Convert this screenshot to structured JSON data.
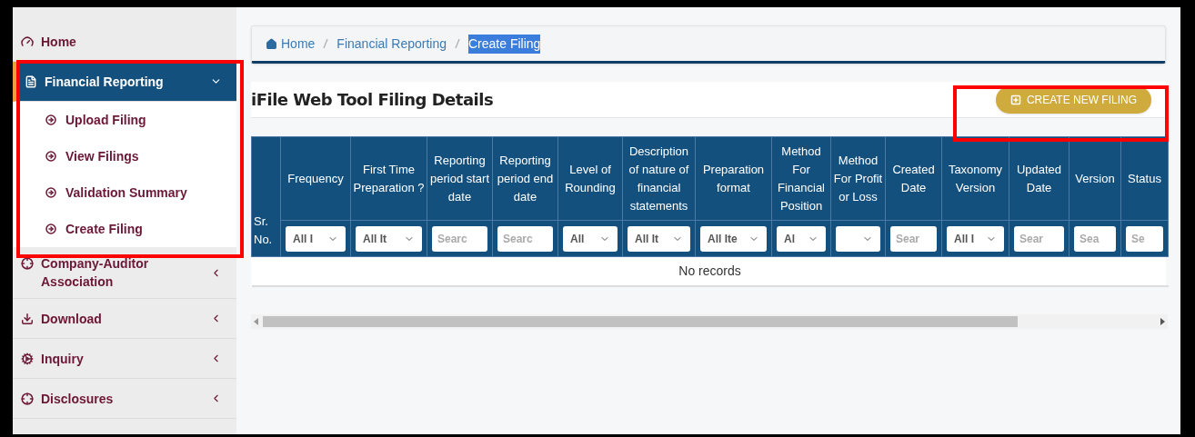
{
  "sidebar": {
    "items": [
      {
        "label": "Home",
        "kind": "link",
        "selected": false
      },
      {
        "label": "Financial Reporting",
        "kind": "group",
        "selected": true,
        "expanded": true,
        "children": [
          {
            "label": "Upload Filing",
            "selected": false
          },
          {
            "label": "View Filings",
            "selected": false
          },
          {
            "label": "Validation Summary",
            "selected": false
          },
          {
            "label": "Create Filing",
            "selected": false
          }
        ]
      },
      {
        "label": "Company-Auditor Association",
        "kind": "group",
        "selected": false,
        "expanded": false
      },
      {
        "label": "Download",
        "kind": "group",
        "selected": false,
        "expanded": false
      },
      {
        "label": "Inquiry",
        "kind": "group",
        "selected": false,
        "expanded": false
      },
      {
        "label": "Disclosures",
        "kind": "group",
        "selected": false,
        "expanded": false
      }
    ]
  },
  "breadcrumb": [
    {
      "label": "Home",
      "selected": false
    },
    {
      "label": "Financial Reporting",
      "selected": false
    },
    {
      "label": "Create Filing",
      "selected": true
    }
  ],
  "title": "iFile Web Tool Filing Details",
  "create_button": "CREATE NEW FILING",
  "table": {
    "columns": [
      {
        "label": "Sr. No."
      },
      {
        "label": "Frequency",
        "filter": {
          "kind": "select",
          "value": "All I"
        }
      },
      {
        "label": "First Time Preparation ?",
        "filter": {
          "kind": "select",
          "value": "All It"
        }
      },
      {
        "label": "Reporting period start date",
        "filter": {
          "kind": "search",
          "placeholder": "Searc"
        }
      },
      {
        "label": "Reporting period end date",
        "filter": {
          "kind": "search",
          "placeholder": "Searc"
        }
      },
      {
        "label": "Level of Rounding",
        "filter": {
          "kind": "select",
          "value": "All"
        }
      },
      {
        "label": "Description of nature of financial statements",
        "filter": {
          "kind": "select",
          "value": "All It"
        }
      },
      {
        "label": "Preparation format",
        "filter": {
          "kind": "select",
          "value": "All Ite"
        }
      },
      {
        "label": "Method For Financial Position",
        "filter": {
          "kind": "select",
          "value": "Al"
        }
      },
      {
        "label": "Method For Profit or Loss",
        "filter": {
          "kind": "select"
        }
      },
      {
        "label": "Created Date",
        "filter": {
          "kind": "search",
          "placeholder": "Sear"
        }
      },
      {
        "label": "Taxonomy Version",
        "filter": {
          "kind": "select",
          "value": "All I"
        }
      },
      {
        "label": "Updated Date",
        "filter": {
          "kind": "search",
          "placeholder": "Sear"
        }
      },
      {
        "label": "Version",
        "filter": {
          "kind": "search",
          "placeholder": "Sea"
        }
      },
      {
        "label": "Status",
        "filter": {
          "kind": "search",
          "placeholder": "Se"
        }
      }
    ],
    "empty_message": "No records"
  }
}
